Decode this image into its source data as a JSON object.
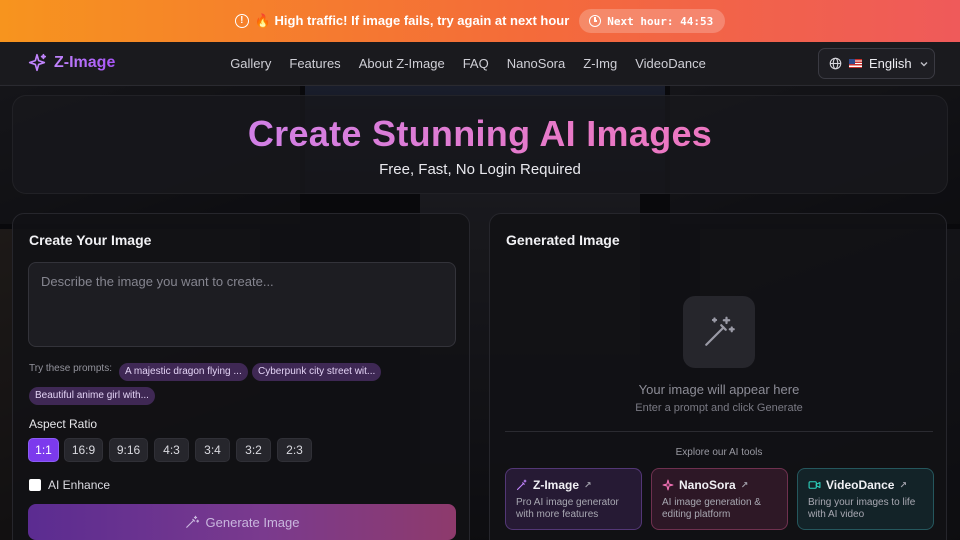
{
  "banner": {
    "message": "🔥 High traffic! If image fails, try again at next hour",
    "timer": "Next hour: 44:53"
  },
  "nav": {
    "logo": "Z-Image",
    "links": [
      "Gallery",
      "Features",
      "About Z-Image",
      "FAQ",
      "NanoSora",
      "Z-Img",
      "VideoDance"
    ],
    "language": "English"
  },
  "hero": {
    "title": "Create Stunning AI Images",
    "subtitle": "Free, Fast, No Login Required"
  },
  "create": {
    "title": "Create Your Image",
    "prompt_placeholder": "Describe the image you want to create...",
    "try_label": "Try these prompts:",
    "suggestions": [
      "A majestic dragon flying ...",
      "Cyberpunk city street wit...",
      "Beautiful anime girl with..."
    ],
    "aspect_label": "Aspect Ratio",
    "ratios": [
      "1:1",
      "16:9",
      "9:16",
      "4:3",
      "3:4",
      "3:2",
      "2:3"
    ],
    "selected_ratio": "1:1",
    "enhance_label": "AI Enhance",
    "generate_label": "Generate Image"
  },
  "result": {
    "title": "Generated Image",
    "placeholder_main": "Your image will appear here",
    "placeholder_sub": "Enter a prompt and click Generate",
    "explore_label": "Explore our AI tools",
    "tools": [
      {
        "name": "Z-Image",
        "desc": "Pro AI image generator with more features"
      },
      {
        "name": "NanoSora",
        "desc": "AI image generation & editing platform"
      },
      {
        "name": "VideoDance",
        "desc": "Bring your images to life with AI video"
      }
    ]
  },
  "colors": {
    "banner_start": "#f7941e",
    "banner_end": "#ef5a5a",
    "accent": "#7c3aed",
    "title_gradient_start": "#c084fc",
    "title_gradient_end": "#f472b6"
  }
}
